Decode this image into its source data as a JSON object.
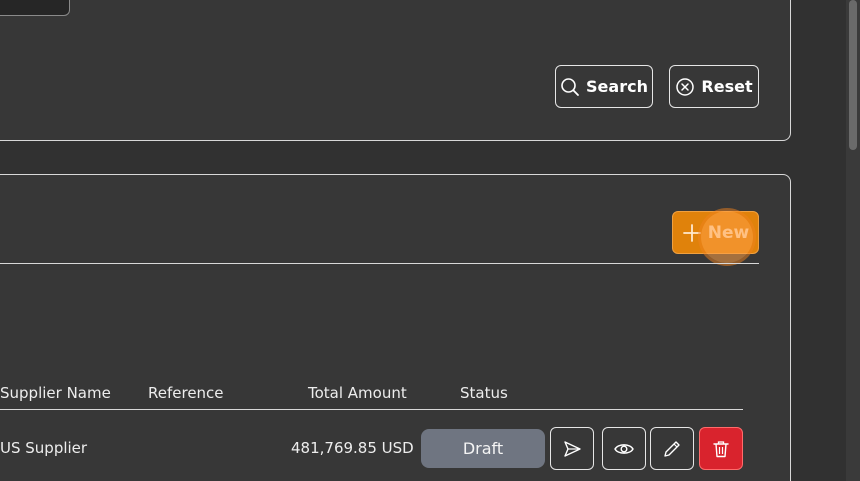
{
  "filters": {
    "search_label": "Search",
    "reset_label": "Reset"
  },
  "list": {
    "new_label": "New",
    "columns": [
      "Supplier Name",
      "Reference",
      "Total Amount",
      "Status"
    ],
    "rows": [
      {
        "supplier_name": "US Supplier",
        "reference": "",
        "total_amount": "481,769.85 USD",
        "status": "Draft"
      }
    ]
  },
  "colors": {
    "new_button": "#e0820b",
    "delete_button": "#d9232d",
    "draft_badge": "#6f7581"
  },
  "icons": {
    "search": "search-icon",
    "reset": "close-circle-icon",
    "new": "plus-icon",
    "send": "send-icon",
    "view": "eye-icon",
    "edit": "pencil-icon",
    "delete": "trash-icon"
  }
}
